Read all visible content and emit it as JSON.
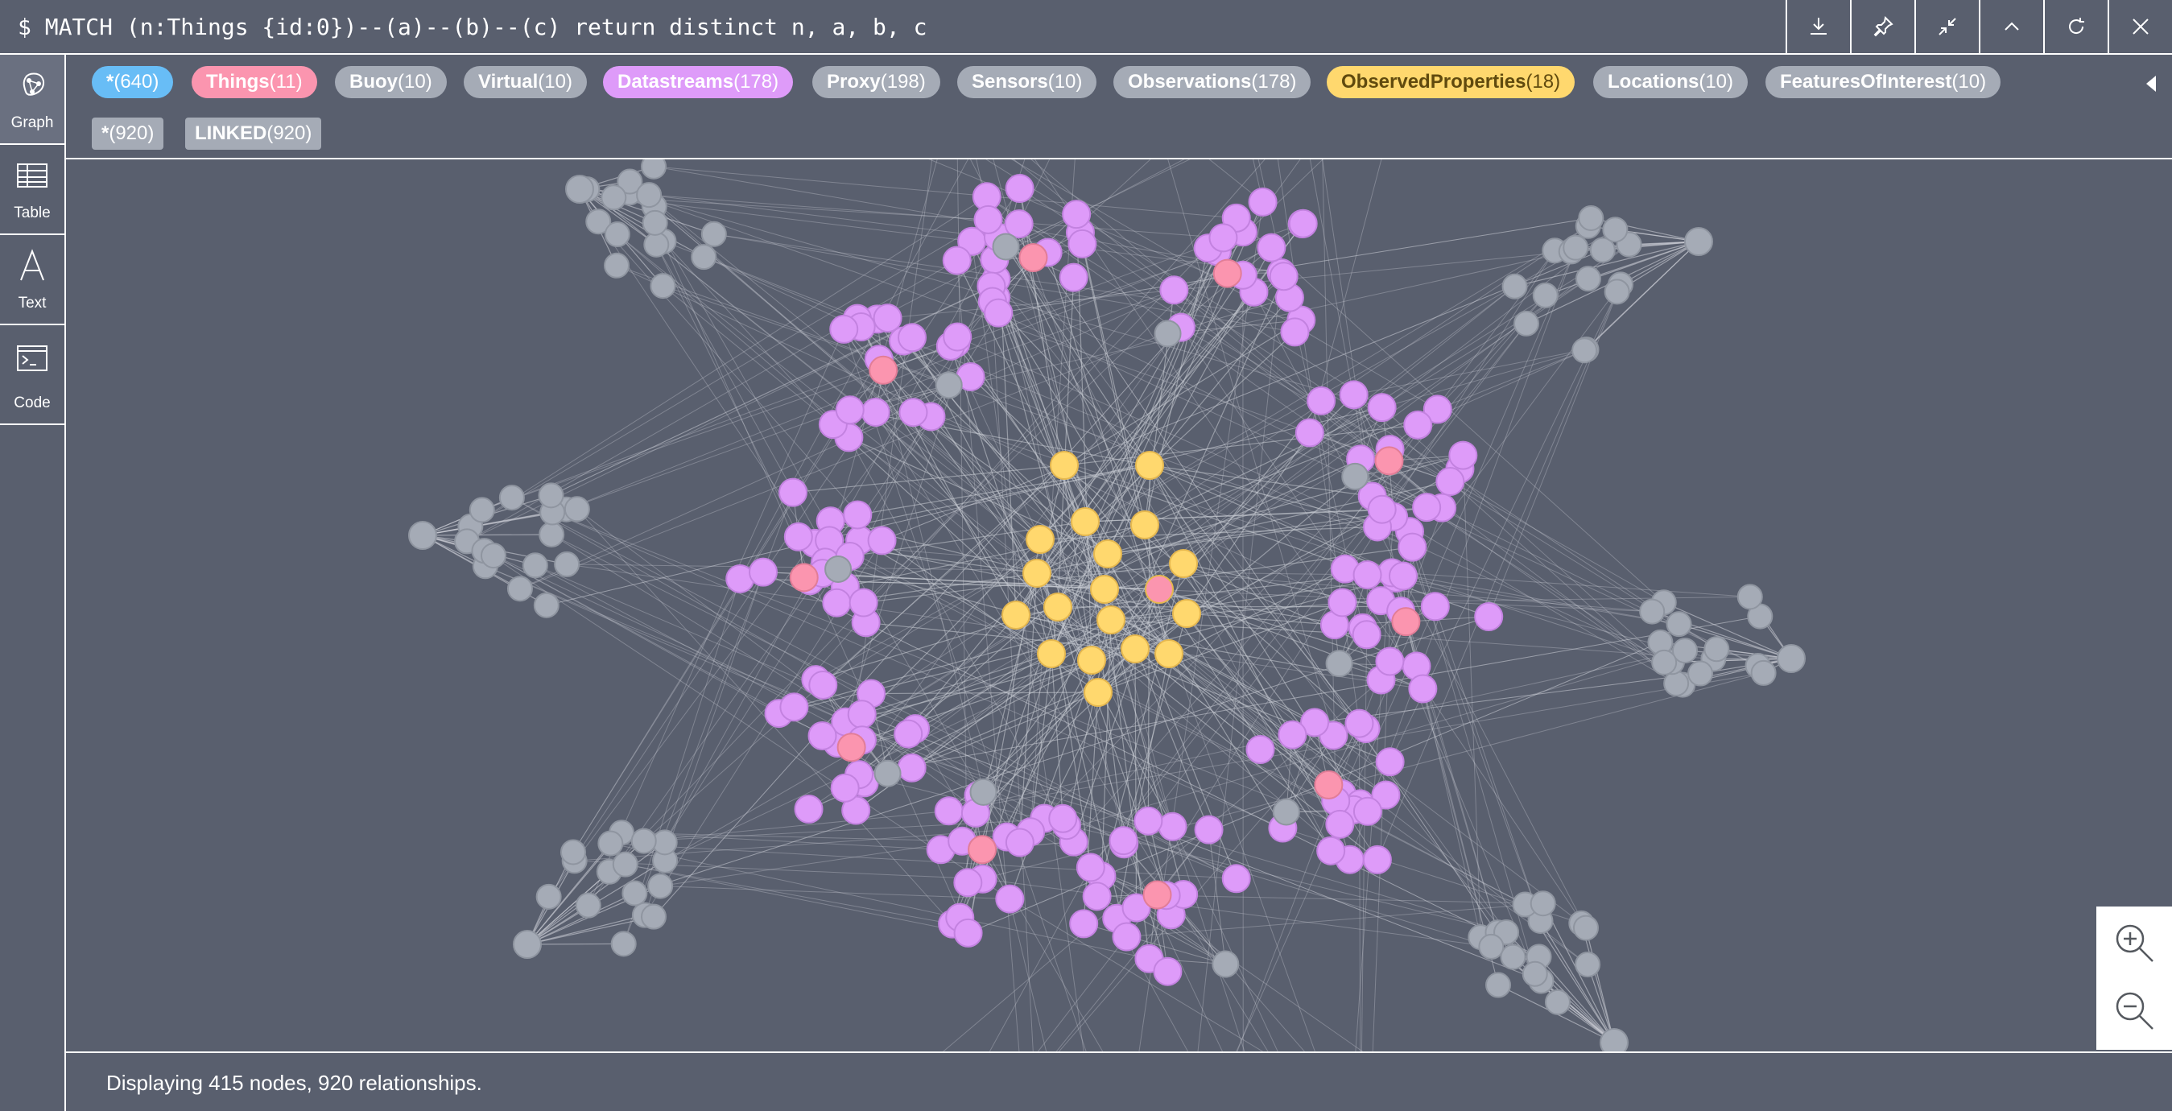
{
  "query": "$ MATCH (n:Things {id:0})--(a)--(b)--(c) return distinct n, a, b, c",
  "toolbar": {
    "buttons": [
      {
        "name": "download-button",
        "icon": "download-icon"
      },
      {
        "name": "pin-button",
        "icon": "pin-icon"
      },
      {
        "name": "collapse-button",
        "icon": "collapse-icon"
      },
      {
        "name": "minimize-button",
        "icon": "chevron-up-icon"
      },
      {
        "name": "rerun-button",
        "icon": "refresh-icon"
      },
      {
        "name": "close-button",
        "icon": "close-icon"
      }
    ]
  },
  "sidebar": {
    "items": [
      {
        "label": "Graph",
        "icon": "graph-icon",
        "active": true
      },
      {
        "label": "Table",
        "icon": "table-icon",
        "active": false
      },
      {
        "label": "Text",
        "icon": "text-icon",
        "active": false
      },
      {
        "label": "Code",
        "icon": "code-icon",
        "active": false
      }
    ]
  },
  "legend": {
    "labels": [
      {
        "name": "*",
        "count": "(640)",
        "color": "#68bdf6",
        "text_color": "#ffffff"
      },
      {
        "name": "Things",
        "count": "(11)",
        "color": "#fb95af",
        "text_color": "#ffffff"
      },
      {
        "name": "Buoy",
        "count": "(10)",
        "color": "#a5abb6",
        "text_color": "#ffffff"
      },
      {
        "name": "Virtual",
        "count": "(10)",
        "color": "#a5abb6",
        "text_color": "#ffffff"
      },
      {
        "name": "Datastreams",
        "count": "(178)",
        "color": "#de9bf9",
        "text_color": "#ffffff"
      },
      {
        "name": "Proxy",
        "count": "(198)",
        "color": "#a5abb6",
        "text_color": "#ffffff"
      },
      {
        "name": "Sensors",
        "count": "(10)",
        "color": "#a5abb6",
        "text_color": "#ffffff"
      },
      {
        "name": "Observations",
        "count": "(178)",
        "color": "#a5abb6",
        "text_color": "#ffffff"
      },
      {
        "name": "ObservedProperties",
        "count": "(18)",
        "color": "#ffd86e",
        "text_color": "#604a0e"
      },
      {
        "name": "Locations",
        "count": "(10)",
        "color": "#a5abb6",
        "text_color": "#ffffff"
      },
      {
        "name": "FeaturesOfInterest",
        "count": "(10)",
        "color": "#a5abb6",
        "text_color": "#ffffff"
      }
    ],
    "relationships": [
      {
        "name": "*",
        "count": "(920)"
      },
      {
        "name": "LINKED",
        "count": "(920)"
      }
    ]
  },
  "graph": {
    "colors": {
      "gray": "#a5abb6",
      "pink": "#fb95af",
      "violet": "#de9bf9",
      "yellow": "#ffd86e",
      "edge": "#c9ccd3"
    }
  },
  "zoom": {
    "in_icon": "zoom-in-icon",
    "out_icon": "zoom-out-icon"
  },
  "status": "Displaying 415 nodes, 920 relationships."
}
